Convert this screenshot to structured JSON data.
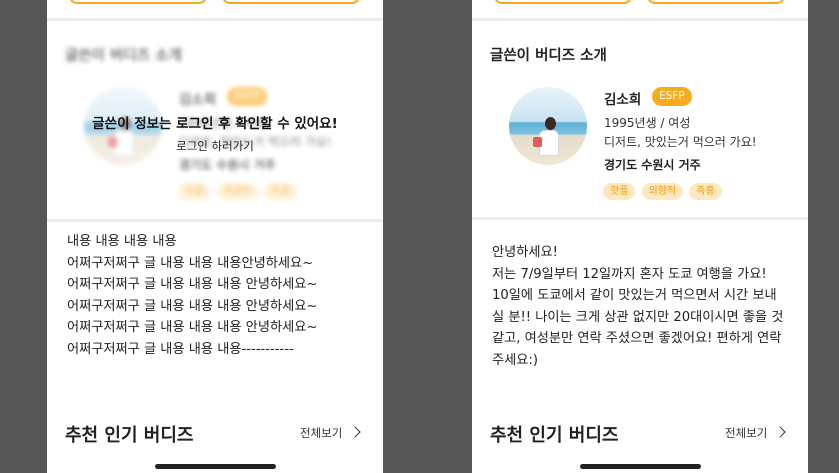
{
  "left": {
    "section_title": "글쓴이 버디즈 소개",
    "profile": {
      "name": "김소희",
      "mbti": "ESFP",
      "birth": "1995년생 / 여성",
      "intro": "디저트, 맛있는거 먹으러 가요!",
      "location": "경기도 수원시 거주",
      "tags": [
        "핫플",
        "외향적",
        "즉흥"
      ]
    },
    "lock_message": "글쓴이 정보는 로그인 후 확인할 수 있어요!",
    "login_link": "로그인 하러가기",
    "body": "내용 내용 내용 내용\n어쩌구저쩌구 글 내용 내용 내용안녕하세요~\n어쩌구저쩌구 글 내용 내용 내용 안녕하세요~\n어쩌구저쩌구 글 내용 내용 내용 안녕하세요~\n어쩌구저쩌구 글 내용 내용 내용 안녕하세요~\n어쩌구저쩌구 글 내용 내용 내용-----------",
    "recommend_title": "추천 인기 버디즈",
    "view_all": "전체보기"
  },
  "right": {
    "section_title": "글쓴이 버디즈 소개",
    "profile": {
      "name": "김소희",
      "mbti": "ESFP",
      "birth": "1995년생 / 여성",
      "intro": "디저트, 맛있는거 먹으러 가요!",
      "location": "경기도 수원시 거주",
      "tags": [
        "핫플",
        "외향적",
        "즉흥"
      ]
    },
    "body": "안녕하세요!\n저는 7/9일부터 12일까지 혼자 도쿄 여행을 가요!\n10일에 도쿄에서 같이 맛있는거 먹으면서 시간 보내\n실 분!! 나이는 크게 상관 없지만 20대이시면 좋을 것\n같고, 여성분만 연락 주셨으면 좋겠어요! 편하게 연락\n주세요:)",
    "recommend_title": "추천 인기 버디즈",
    "view_all": "전체보기"
  },
  "colors": {
    "accent": "#f8ab1c",
    "tag_bg": "#fde9bf",
    "tag_text": "#f19a12",
    "backdrop": "#565656"
  },
  "icons": {
    "view_all": "chevron-right-icon"
  }
}
